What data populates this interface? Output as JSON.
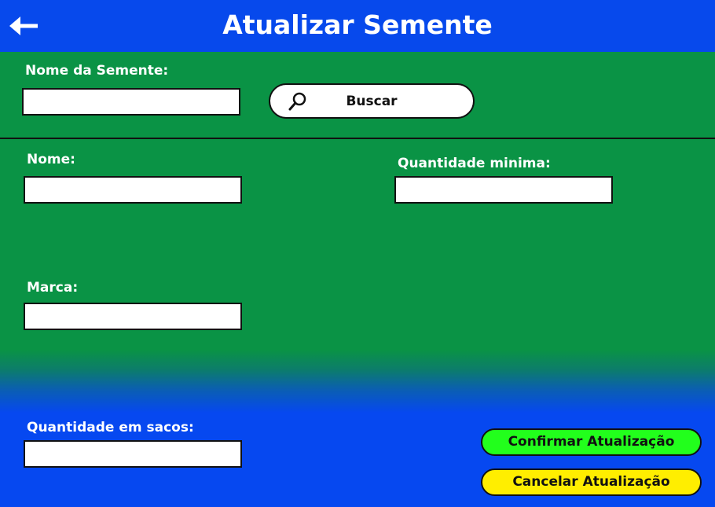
{
  "header": {
    "title": "Atualizar Semente",
    "back_icon": "arrow-left-icon",
    "background": "#0749ec"
  },
  "search": {
    "label": "Nome da Semente:",
    "value": "",
    "button_label": "Buscar",
    "button_icon": "search-icon"
  },
  "form": {
    "nome_label": "Nome:",
    "nome_value": "",
    "quantidade_minima_label": "Quantidade minima:",
    "quantidade_minima_value": "",
    "marca_label": "Marca:",
    "marca_value": "",
    "quantidade_sacos_label": "Quantidade em sacos:",
    "quantidade_sacos_value": ""
  },
  "actions": {
    "confirm_label": "Confirmar Atualização",
    "confirm_color": "#22ff1c",
    "cancel_label": "Cancelar Atualização",
    "cancel_color": "#ffee00"
  },
  "colors": {
    "green": "#0a9345",
    "blue": "#0648f0"
  }
}
